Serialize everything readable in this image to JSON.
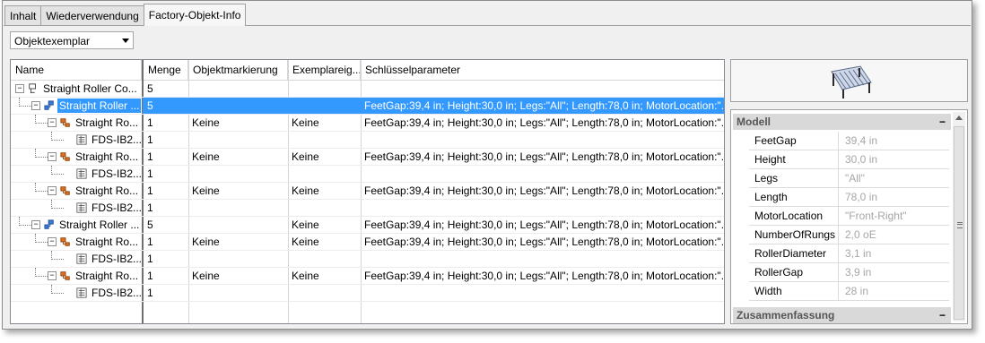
{
  "tabs": [
    {
      "label": "Inhalt",
      "active": false
    },
    {
      "label": "Wiederverwendung",
      "active": false
    },
    {
      "label": "Factory-Objekt-Info",
      "active": true
    }
  ],
  "dropdown": {
    "value": "Objektexemplar"
  },
  "grid": {
    "columns": [
      "Name",
      "Menge",
      "Objektmarkierung",
      "Exemplareig...",
      "Schlüsselparameter"
    ],
    "rows": [
      {
        "name": "Straight Roller Co...",
        "menge": "5",
        "mark": "",
        "exemplar": "",
        "params": "",
        "level": 0,
        "icon": "assembly-icon",
        "expander": "minus",
        "selected": false
      },
      {
        "name": "Straight Roller ...",
        "menge": "5",
        "mark": "",
        "exemplar": "",
        "params": "FeetGap:39,4 in; Height:30,0 in; Legs:\"All\"; Length:78,0 in; MotorLocation:\"...",
        "level": 1,
        "icon": "subassembly-icon",
        "expander": "minus",
        "selected": true
      },
      {
        "name": "Straight Ro...",
        "menge": "1",
        "mark": "Keine",
        "exemplar": "Keine",
        "params": "FeetGap:39,4 in; Height:30,0 in; Legs:\"All\"; Length:78,0 in; MotorLocation:\"...",
        "level": 2,
        "icon": "part-icon",
        "expander": "minus",
        "selected": false
      },
      {
        "name": "FDS-IB2...",
        "menge": "1",
        "mark": "",
        "exemplar": "",
        "params": "",
        "level": 3,
        "icon": "drawing-icon",
        "expander": "",
        "selected": false
      },
      {
        "name": "Straight Ro...",
        "menge": "1",
        "mark": "Keine",
        "exemplar": "Keine",
        "params": "FeetGap:39,4 in; Height:30,0 in; Legs:\"All\"; Length:78,0 in; MotorLocation:\"...",
        "level": 2,
        "icon": "part-icon",
        "expander": "minus",
        "selected": false
      },
      {
        "name": "FDS-IB2...",
        "menge": "1",
        "mark": "",
        "exemplar": "",
        "params": "",
        "level": 3,
        "icon": "drawing-icon",
        "expander": "",
        "selected": false
      },
      {
        "name": "Straight Ro...",
        "menge": "1",
        "mark": "Keine",
        "exemplar": "Keine",
        "params": "FeetGap:39,4 in; Height:30,0 in; Legs:\"All\"; Length:78,0 in; MotorLocation:\"...",
        "level": 2,
        "icon": "part-icon",
        "expander": "minus",
        "selected": false
      },
      {
        "name": "FDS-IB2...",
        "menge": "1",
        "mark": "",
        "exemplar": "",
        "params": "",
        "level": 3,
        "icon": "drawing-icon",
        "expander": "",
        "selected": false
      },
      {
        "name": "Straight Roller ...",
        "menge": "5",
        "mark": "",
        "exemplar": "Keine",
        "params": "FeetGap:39,4 in; Height:30,0 in; Legs:\"All\"; Length:78,0 in; MotorLocation:\"...",
        "level": 1,
        "icon": "subassembly-icon",
        "expander": "minus",
        "selected": false
      },
      {
        "name": "Straight Ro...",
        "menge": "1",
        "mark": "Keine",
        "exemplar": "Keine",
        "params": "FeetGap:39,4 in; Height:30,0 in; Legs:\"All\"; Length:78,0 in; MotorLocation:\"...",
        "level": 2,
        "icon": "part-icon",
        "expander": "minus",
        "selected": false
      },
      {
        "name": "FDS-IB2...",
        "menge": "1",
        "mark": "",
        "exemplar": "",
        "params": "",
        "level": 3,
        "icon": "drawing-icon",
        "expander": "",
        "selected": false
      },
      {
        "name": "Straight Ro...",
        "menge": "1",
        "mark": "Keine",
        "exemplar": "Keine",
        "params": "FeetGap:39,4 in; Height:30,0 in; Legs:\"All\"; Length:78,0 in; MotorLocation:\"...",
        "level": 2,
        "icon": "part-icon",
        "expander": "minus",
        "selected": false
      },
      {
        "name": "FDS-IB2...",
        "menge": "1",
        "mark": "",
        "exemplar": "",
        "params": "",
        "level": 3,
        "icon": "drawing-icon",
        "expander": "",
        "selected": false
      }
    ]
  },
  "properties": {
    "sections": [
      {
        "title": "Modell",
        "collapse_glyph": "−"
      },
      {
        "title": "Zusammenfassung",
        "collapse_glyph": "−"
      }
    ],
    "items": [
      {
        "name": "FeetGap",
        "value": "39,4 in"
      },
      {
        "name": "Height",
        "value": "30,0 in"
      },
      {
        "name": "Legs",
        "value": "\"All\""
      },
      {
        "name": "Length",
        "value": "78,0 in"
      },
      {
        "name": "MotorLocation",
        "value": "\"Front-Right\""
      },
      {
        "name": "NumberOfRungs",
        "value": "2,0 oE"
      },
      {
        "name": "RollerDiameter",
        "value": "3,1 in"
      },
      {
        "name": "RollerGap",
        "value": "3,9 in"
      },
      {
        "name": "Width",
        "value": "28 in"
      }
    ]
  },
  "colors": {
    "selection": "#3399ff",
    "tab_active": "#f7f7f7"
  }
}
